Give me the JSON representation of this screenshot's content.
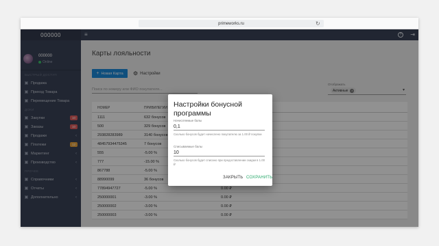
{
  "browser": {
    "url": "primeworks.ru",
    "reload_icon": "reload-icon"
  },
  "sidebar": {
    "brand": "000000",
    "user_name": "000000",
    "user_status": "Online",
    "sections": {
      "main": "БЫСТРЫЙ ДОСТУП",
      "docs": "ДОКИ",
      "extra": "ПРОЧЕЕ"
    },
    "items": [
      {
        "label": "Продажа"
      },
      {
        "label": "Приход Товара"
      },
      {
        "label": "Перемещение Товара"
      },
      {
        "label": "Закупки",
        "badge": "10"
      },
      {
        "label": "Заказы",
        "badge": "10"
      },
      {
        "label": "Продажи"
      },
      {
        "label": "Платежи",
        "badge": "12"
      },
      {
        "label": "Маркетинг"
      },
      {
        "label": "Производство"
      },
      {
        "label": "Справочники"
      },
      {
        "label": "Отчеты"
      },
      {
        "label": "Дополнительно"
      }
    ]
  },
  "topbar": {
    "menu_icon": "hamburger-icon",
    "help_icon": "help-icon",
    "exit_icon": "logout-icon"
  },
  "main": {
    "title": "Карты лояльности",
    "new_button": "Новая Карта",
    "settings_label": "Настройки",
    "search_placeholder": "Поиск по номеру или ФИО покупателя...",
    "filter_label": "Отображать",
    "filter_value": "Активные",
    "table": {
      "headers": [
        "НОМЕР",
        "ПРИВИЛЕГИИ",
        ""
      ],
      "rows": [
        [
          "1111",
          "632 бонусов",
          ""
        ],
        [
          "500",
          "329 бонусов",
          ""
        ],
        [
          "293828283989",
          "3140 бонусов",
          ""
        ],
        [
          "48457934475345",
          "7 бонусов",
          ""
        ],
        [
          "555",
          "-5.00 %",
          ""
        ],
        [
          "777",
          "-15.00 %",
          ""
        ],
        [
          "867788",
          "-5.00 %",
          ""
        ],
        [
          "88990099",
          "36 бонусов",
          ""
        ],
        [
          "77894947727",
          "-5.00 %",
          "0.00 ₽"
        ],
        [
          "250000001",
          "-3.00 %",
          "0.00 ₽"
        ],
        [
          "250000002",
          "-3.00 %",
          "0.00 ₽"
        ],
        [
          "250000003",
          "-3.00 %",
          "0.00 ₽"
        ]
      ]
    }
  },
  "dialog": {
    "title": "Настройки бонусной программы",
    "field1_label": "Начисляемые балы",
    "field1_value": "0,1",
    "field1_hint": "Сколько бонусов будет начислено покупателю за 1.00 ₽ покупки",
    "field2_label": "Списываемые балы",
    "field2_value": "10",
    "field2_hint": "Сколько бонусов будет списано при предоставлении скидки в 1.00 ₽",
    "close_label": "ЗАКРЫТЬ",
    "save_label": "СОХРАНИТЬ"
  },
  "colors": {
    "sidebar": "#3a4256",
    "primary": "#1b88d8",
    "save": "#27a86a"
  }
}
